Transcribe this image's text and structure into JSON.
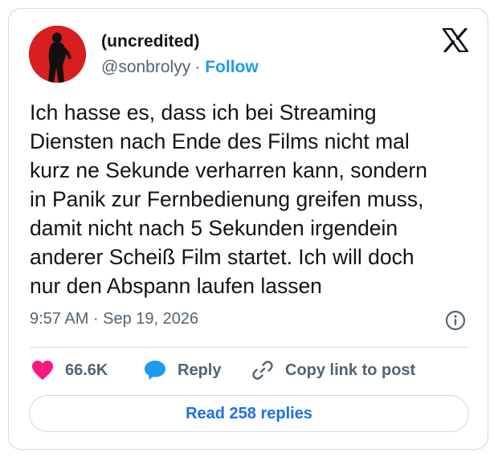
{
  "author": {
    "display_name": "(uncredited)",
    "handle": "@sonbrolyy",
    "separator": "·",
    "follow_label": "Follow"
  },
  "tweet": {
    "text_lines": [
      "Ich hasse es, dass ich bei Streaming",
      "Diensten nach Ende des Films nicht mal",
      "kurz ne Sekunde verharren kann, sondern",
      "in Panik zur Fernbedienung greifen muss,",
      "damit nicht nach 5 Sekunden irgendein",
      "anderer Scheiß Film startet. Ich will doch",
      "nur den Abspann laufen lassen"
    ],
    "timestamp": "9:57 AM · Sep 19, 2026"
  },
  "actions": {
    "like_count": "66.6K",
    "reply_label": "Reply",
    "copy_label": "Copy link to post"
  },
  "read_replies_label": "Read 258 replies",
  "icons": {
    "brand": "x-logo-icon",
    "info": "info-icon",
    "like": "heart-icon",
    "reply": "speech-bubble-icon",
    "copy": "link-icon"
  },
  "colors": {
    "like": "#f91880",
    "reply": "#1d9bf0",
    "follow": "#1d9bf0",
    "avatar_bg": "#d81e1e",
    "secondary_text": "#536471",
    "border": "#cfd9de"
  }
}
